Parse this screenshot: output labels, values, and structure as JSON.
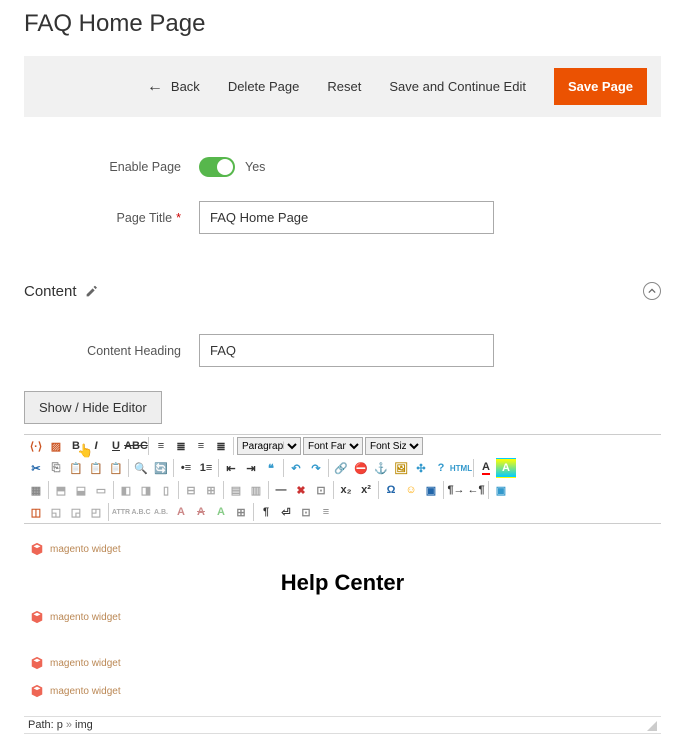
{
  "page": {
    "title": "FAQ Home Page"
  },
  "actions": {
    "back": "Back",
    "delete": "Delete Page",
    "reset": "Reset",
    "saveContinue": "Save and Continue Edit",
    "save": "Save Page"
  },
  "fields": {
    "enableLabel": "Enable Page",
    "enableValue": "Yes",
    "titleLabel": "Page Title",
    "titleValue": "FAQ Home Page"
  },
  "content": {
    "sectionTitle": "Content",
    "headingLabel": "Content Heading",
    "headingValue": "FAQ",
    "showHide": "Show / Hide Editor"
  },
  "editor": {
    "formatSelect": "Paragraph",
    "fontFamilySelect": "Font Family",
    "fontSizeSelect": "Font Size",
    "widgetText": "magento widget",
    "helpCenter": "Help Center",
    "pathLabel": "Path:",
    "pathP": "p",
    "pathImg": "img"
  },
  "colors": {
    "accent": "#eb5202",
    "toggleOn": "#57b74c"
  }
}
